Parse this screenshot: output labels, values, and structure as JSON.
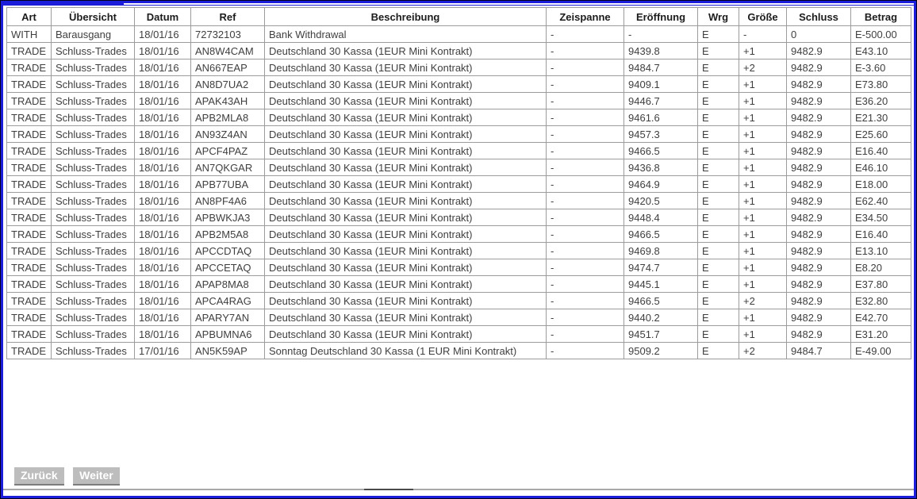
{
  "frame": {
    "accent_color": "#1c1cdb"
  },
  "table": {
    "columns": [
      {
        "key": "art",
        "label": "Art"
      },
      {
        "key": "uebersicht",
        "label": "Übersicht"
      },
      {
        "key": "datum",
        "label": "Datum"
      },
      {
        "key": "ref",
        "label": "Ref"
      },
      {
        "key": "beschreibung",
        "label": "Beschreibung"
      },
      {
        "key": "zeispanne",
        "label": "Zeispanne"
      },
      {
        "key": "eroeffnung",
        "label": "Eröffnung"
      },
      {
        "key": "wrg",
        "label": "Wrg"
      },
      {
        "key": "groesse",
        "label": "Größe"
      },
      {
        "key": "schluss",
        "label": "Schluss"
      },
      {
        "key": "betrag",
        "label": "Betrag"
      }
    ],
    "rows": [
      [
        "WITH",
        "Barausgang",
        "18/01/16",
        "72732103",
        "Bank Withdrawal",
        "-",
        "-",
        "E",
        "-",
        "0",
        "E-500.00"
      ],
      [
        "TRADE",
        "Schluss-Trades",
        "18/01/16",
        "AN8W4CAM",
        "Deutschland 30 Kassa (1EUR Mini Kontrakt)",
        "-",
        "9439.8",
        "E",
        "+1",
        "9482.9",
        "E43.10"
      ],
      [
        "TRADE",
        "Schluss-Trades",
        "18/01/16",
        "AN667EAP",
        "Deutschland 30 Kassa (1EUR Mini Kontrakt)",
        "-",
        "9484.7",
        "E",
        "+2",
        "9482.9",
        "E-3.60"
      ],
      [
        "TRADE",
        "Schluss-Trades",
        "18/01/16",
        "AN8D7UA2",
        "Deutschland 30 Kassa (1EUR Mini Kontrakt)",
        "-",
        "9409.1",
        "E",
        "+1",
        "9482.9",
        "E73.80"
      ],
      [
        "TRADE",
        "Schluss-Trades",
        "18/01/16",
        "APAK43AH",
        "Deutschland 30 Kassa (1EUR Mini Kontrakt)",
        "-",
        "9446.7",
        "E",
        "+1",
        "9482.9",
        "E36.20"
      ],
      [
        "TRADE",
        "Schluss-Trades",
        "18/01/16",
        "APB2MLA8",
        "Deutschland 30 Kassa (1EUR Mini Kontrakt)",
        "-",
        "9461.6",
        "E",
        "+1",
        "9482.9",
        "E21.30"
      ],
      [
        "TRADE",
        "Schluss-Trades",
        "18/01/16",
        "AN93Z4AN",
        "Deutschland 30 Kassa (1EUR Mini Kontrakt)",
        "-",
        "9457.3",
        "E",
        "+1",
        "9482.9",
        "E25.60"
      ],
      [
        "TRADE",
        "Schluss-Trades",
        "18/01/16",
        "APCF4PAZ",
        "Deutschland 30 Kassa (1EUR Mini Kontrakt)",
        "-",
        "9466.5",
        "E",
        "+1",
        "9482.9",
        "E16.40"
      ],
      [
        "TRADE",
        "Schluss-Trades",
        "18/01/16",
        "AN7QKGAR",
        "Deutschland 30 Kassa (1EUR Mini Kontrakt)",
        "-",
        "9436.8",
        "E",
        "+1",
        "9482.9",
        "E46.10"
      ],
      [
        "TRADE",
        "Schluss-Trades",
        "18/01/16",
        "APB77UBA",
        "Deutschland 30 Kassa (1EUR Mini Kontrakt)",
        "-",
        "9464.9",
        "E",
        "+1",
        "9482.9",
        "E18.00"
      ],
      [
        "TRADE",
        "Schluss-Trades",
        "18/01/16",
        "AN8PF4A6",
        "Deutschland 30 Kassa (1EUR Mini Kontrakt)",
        "-",
        "9420.5",
        "E",
        "+1",
        "9482.9",
        "E62.40"
      ],
      [
        "TRADE",
        "Schluss-Trades",
        "18/01/16",
        "APBWKJA3",
        "Deutschland 30 Kassa (1EUR Mini Kontrakt)",
        "-",
        "9448.4",
        "E",
        "+1",
        "9482.9",
        "E34.50"
      ],
      [
        "TRADE",
        "Schluss-Trades",
        "18/01/16",
        "APB2M5A8",
        "Deutschland 30 Kassa (1EUR Mini Kontrakt)",
        "-",
        "9466.5",
        "E",
        "+1",
        "9482.9",
        "E16.40"
      ],
      [
        "TRADE",
        "Schluss-Trades",
        "18/01/16",
        "APCCDTAQ",
        "Deutschland 30 Kassa (1EUR Mini Kontrakt)",
        "-",
        "9469.8",
        "E",
        "+1",
        "9482.9",
        "E13.10"
      ],
      [
        "TRADE",
        "Schluss-Trades",
        "18/01/16",
        "APCCETAQ",
        "Deutschland 30 Kassa (1EUR Mini Kontrakt)",
        "-",
        "9474.7",
        "E",
        "+1",
        "9482.9",
        "E8.20"
      ],
      [
        "TRADE",
        "Schluss-Trades",
        "18/01/16",
        "APAP8MA8",
        "Deutschland 30 Kassa (1EUR Mini Kontrakt)",
        "-",
        "9445.1",
        "E",
        "+1",
        "9482.9",
        "E37.80"
      ],
      [
        "TRADE",
        "Schluss-Trades",
        "18/01/16",
        "APCA4RAG",
        "Deutschland 30 Kassa (1EUR Mini Kontrakt)",
        "-",
        "9466.5",
        "E",
        "+2",
        "9482.9",
        "E32.80"
      ],
      [
        "TRADE",
        "Schluss-Trades",
        "18/01/16",
        "APARY7AN",
        "Deutschland 30 Kassa (1EUR Mini Kontrakt)",
        "-",
        "9440.2",
        "E",
        "+1",
        "9482.9",
        "E42.70"
      ],
      [
        "TRADE",
        "Schluss-Trades",
        "18/01/16",
        "APBUMNA6",
        "Deutschland 30 Kassa (1EUR Mini Kontrakt)",
        "-",
        "9451.7",
        "E",
        "+1",
        "9482.9",
        "E31.20"
      ],
      [
        "TRADE",
        "Schluss-Trades",
        "17/01/16",
        "AN5K59AP",
        "Sonntag Deutschland 30 Kassa (1 EUR Mini Kontrakt)",
        "-",
        "9509.2",
        "E",
        "+2",
        "9484.7",
        "E-49.00"
      ]
    ]
  },
  "pagination": {
    "back_label": "Zurück",
    "next_label": "Weiter"
  }
}
